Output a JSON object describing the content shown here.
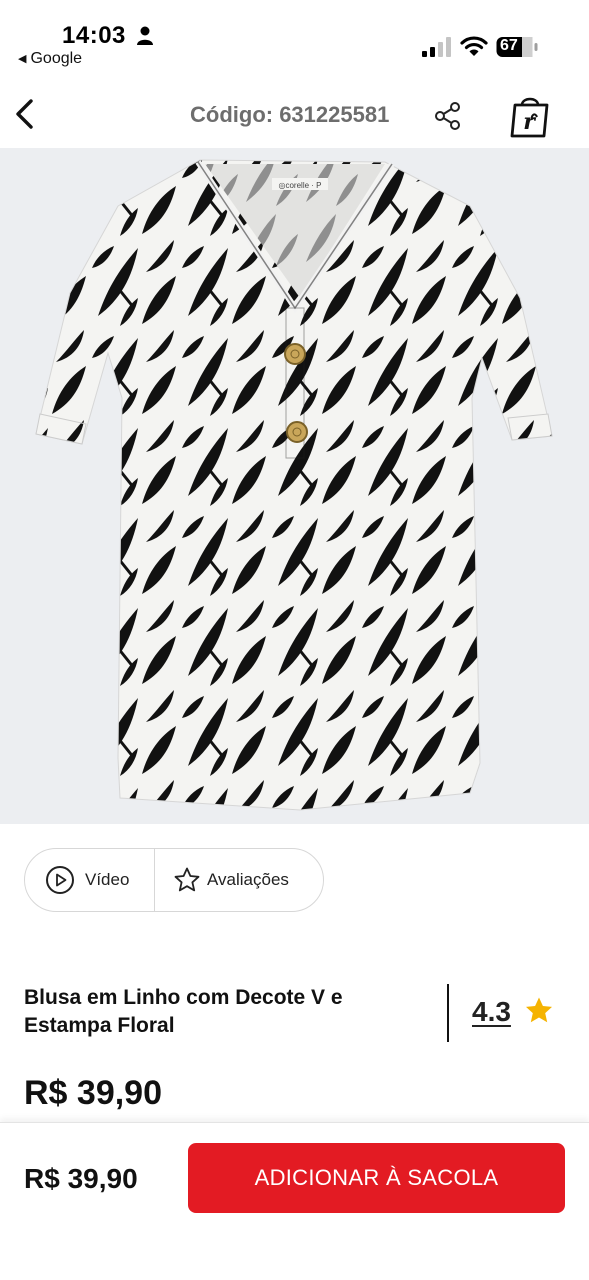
{
  "status_bar": {
    "time": "14:03",
    "back_app": "Google",
    "battery": "67"
  },
  "header": {
    "code_label": "Código: 631225581"
  },
  "media_tabs": {
    "video_label": "Vídeo",
    "reviews_label": "Avaliações"
  },
  "product": {
    "title": "Blusa em Linho com Decote V e Estampa Floral",
    "rating": "4.3",
    "price": "R$ 39,90"
  },
  "bottom_bar": {
    "price": "R$ 39,90",
    "add_button_label": "ADICIONAR À SACOLA"
  },
  "colors": {
    "accent_red": "#e31b23",
    "star_yellow": "#f5b301"
  },
  "icons": [
    "person-icon",
    "signal-icon",
    "wifi-icon",
    "battery-icon",
    "back-icon",
    "share-icon",
    "shopping-bag-icon",
    "play-icon",
    "star-outline-icon",
    "star-icon"
  ]
}
